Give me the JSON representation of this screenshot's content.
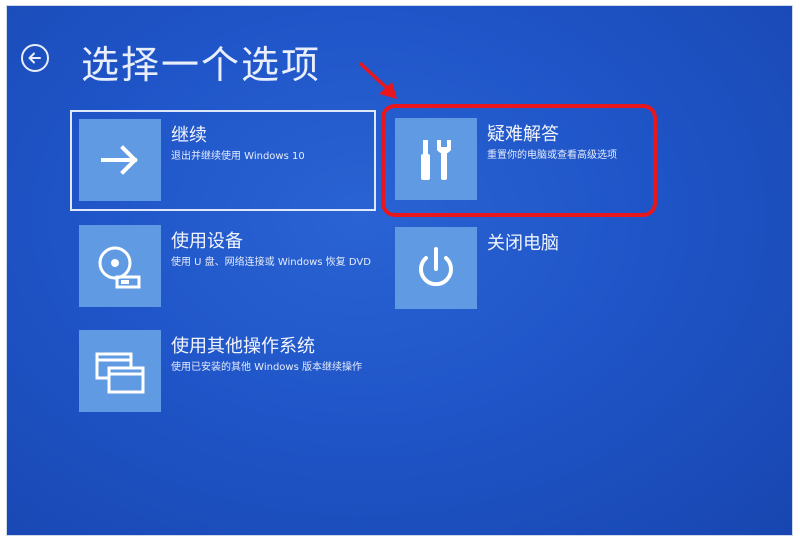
{
  "header": {
    "title": "选择一个选项",
    "back_icon": "back-arrow-circle-icon"
  },
  "tiles": {
    "continue": {
      "title": "继续",
      "desc": "退出并继续使用 Windows 10",
      "icon": "arrow-right-icon"
    },
    "troubleshoot": {
      "title": "疑难解答",
      "desc": "重置你的电脑或查看高级选项",
      "icon": "tools-icon"
    },
    "use_device": {
      "title": "使用设备",
      "desc": "使用 U 盘、网络连接或 Windows 恢复 DVD",
      "icon": "disc-drive-icon"
    },
    "shutdown": {
      "title": "关闭电脑",
      "desc": "",
      "icon": "power-icon"
    },
    "other_os": {
      "title": "使用其他操作系统",
      "desc": "使用已安装的其他 Windows 版本继续操作",
      "icon": "windows-stack-icon"
    }
  },
  "annotations": {
    "highlight_color": "#e8161d",
    "pointer_icon": "red-arrow-icon"
  },
  "colors": {
    "background": "#1f55c8",
    "tile_icon_bg": "#5f9ae2",
    "text": "#f2f5fd"
  }
}
